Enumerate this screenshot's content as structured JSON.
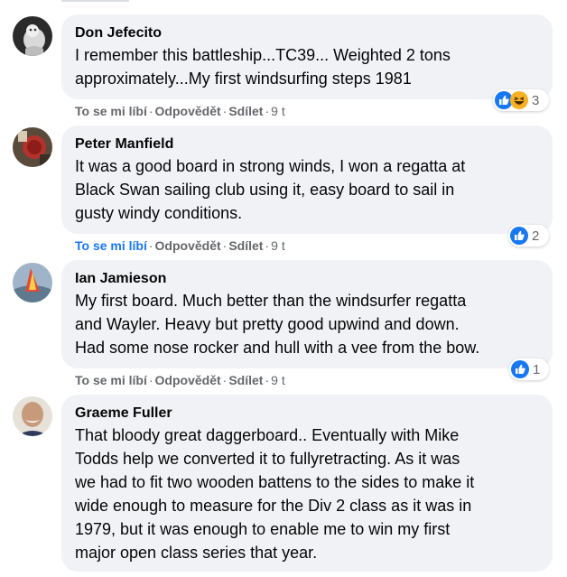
{
  "actions": {
    "like": "To se mi líbí",
    "reply": "Odpovědět",
    "share": "Sdílet",
    "separator": "·"
  },
  "comments": [
    {
      "author": "Don Jefecito",
      "lines": [
        "I remember this battleship...TC39... Weighted 2 tons",
        "approximately...My first windsurfing steps 1981"
      ],
      "time": "9 t",
      "liked": false,
      "reaction_count": "3",
      "reactions": [
        "like-icon",
        "haha-icon"
      ]
    },
    {
      "author": "Peter Manfield",
      "lines": [
        "It was a good board in strong winds, I won a regatta at",
        "Black Swan sailing club using it, easy board to sail in",
        "gusty windy conditions."
      ],
      "time": "9 t",
      "liked": true,
      "reaction_count": "2",
      "reactions": [
        "like-icon"
      ]
    },
    {
      "author": "Ian Jamieson",
      "lines": [
        "My first board. Much better than the windsurfer regatta",
        "and Wayler. Heavy but pretty good upwind and down.",
        "Had some nose rocker and hull with a vee from the bow."
      ],
      "time": "9 t",
      "liked": false,
      "reaction_count": "1",
      "reactions": [
        "like-icon"
      ]
    },
    {
      "author": "Graeme Fuller",
      "lines": [
        "That bloody great daggerboard.. Eventually with Mike",
        "Todds help we converted it to fullyretracting. As it was",
        "we had to fit two wooden battens to the sides to make it",
        "wide enough to measure for the Div 2 class as it was in",
        "1979, but it was enough to enable me to win my first",
        "major open class series that year."
      ],
      "time": "",
      "liked": false,
      "reaction_count": "",
      "reactions": []
    }
  ],
  "colors": {
    "link_blue": "#1877f2",
    "bubble_bg": "#f0f2f5",
    "meta_gray": "#65676b"
  }
}
